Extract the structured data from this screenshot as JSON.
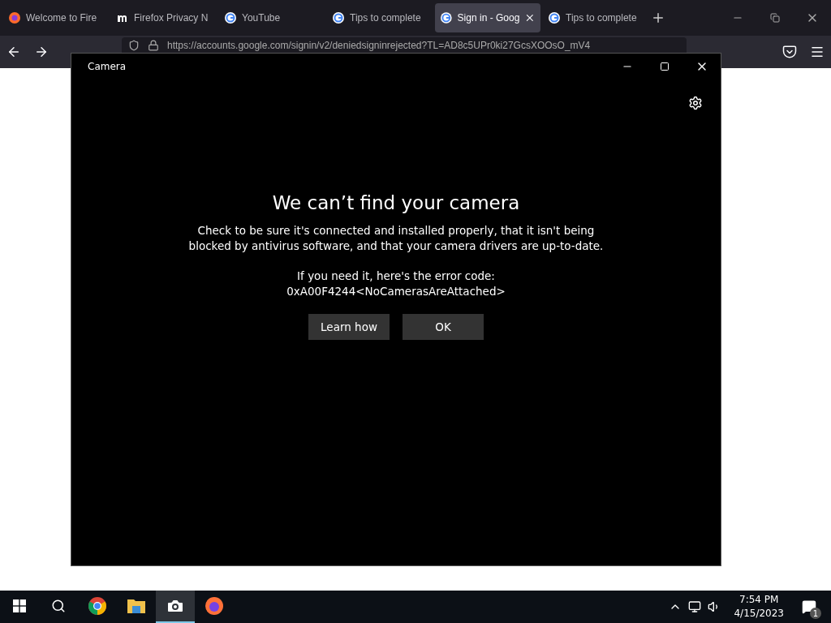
{
  "browser": {
    "tabs": [
      {
        "title": "Welcome to Fire",
        "kind": "firefox",
        "selected": false,
        "closable": false
      },
      {
        "title": "Firefox Privacy N",
        "kind": "m",
        "selected": false,
        "closable": false
      },
      {
        "title": "YouTube",
        "kind": "google",
        "selected": false,
        "closable": false
      },
      {
        "title": "Tips to complete",
        "kind": "google",
        "selected": false,
        "closable": false
      },
      {
        "title": "Sign in - Goog",
        "kind": "google",
        "selected": true,
        "closable": true
      },
      {
        "title": "Tips to complete",
        "kind": "google",
        "selected": false,
        "closable": false
      }
    ],
    "url": "https://accounts.google.com/signin/v2/deniedsigninrejected?TL=AD8c5UPr0ki27GcsXOOsO_mV4"
  },
  "camera_window": {
    "title": "Camera",
    "heading": "We can’t find your camera",
    "message": "Check to be sure it's connected and installed properly, that it isn't being blocked by antivirus software, and that your camera drivers are up-to-date.",
    "error_intro": "If you need it, here's the error code:",
    "error_code": "0xA00F4244<NoCamerasAreAttached>",
    "buttons": [
      "Learn how",
      "OK"
    ]
  },
  "taskbar": {
    "apps": [
      {
        "kind": "chrome",
        "active": false
      },
      {
        "kind": "explorer",
        "active": false
      },
      {
        "kind": "camera",
        "active": true
      },
      {
        "kind": "firefox",
        "active": false
      }
    ],
    "time": "7:54 PM",
    "date": "4/15/2023",
    "notifications": "1"
  }
}
